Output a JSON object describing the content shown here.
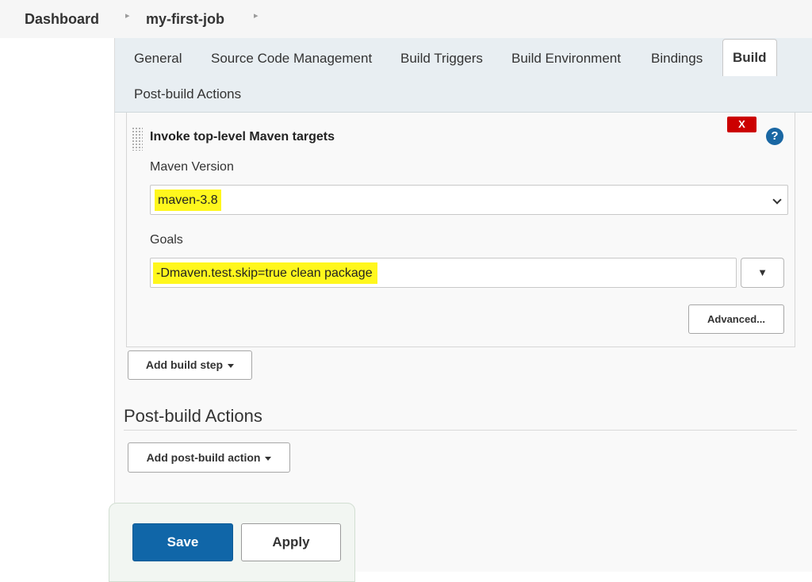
{
  "breadcrumb": {
    "items": [
      "Dashboard",
      "my-first-job"
    ]
  },
  "tabs": [
    "General",
    "Source Code Management",
    "Build Triggers",
    "Build Environment",
    "Bindings",
    "Build",
    "Post-build Actions"
  ],
  "active_tab": "Build",
  "build_step": {
    "title": "Invoke top-level Maven targets",
    "delete_label": "X",
    "help_icon": "?",
    "maven_version_label": "Maven Version",
    "maven_version_value": "maven-3.8",
    "goals_label": "Goals",
    "goals_value": "-Dmaven.test.skip=true clean package",
    "expand_icon": "▼",
    "advanced_label": "Advanced..."
  },
  "add_build_step_label": "Add build step",
  "post_build": {
    "heading": "Post-build Actions",
    "add_label": "Add post-build action"
  },
  "actions": {
    "save_label": "Save",
    "apply_label": "Apply"
  },
  "colors": {
    "highlight": "#fff71d",
    "save_blue": "#1066a8",
    "delete_red": "#cc0000",
    "help_blue": "#1a67a3"
  },
  "icons": [
    "chevron-right-icon",
    "chevron-down-icon",
    "drag-handle-icon",
    "help-icon",
    "caret-down-icon"
  ]
}
